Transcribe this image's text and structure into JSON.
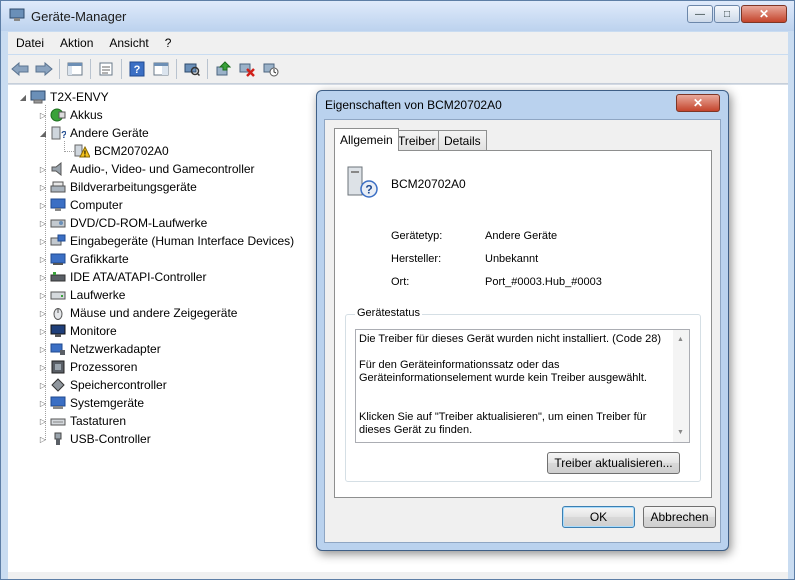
{
  "window": {
    "title": "Geräte-Manager",
    "minimize": "—",
    "maximize": "□",
    "close": "✕"
  },
  "menu": [
    "Datei",
    "Aktion",
    "Ansicht",
    "?"
  ],
  "toolbar_icons": [
    "back-arrow-icon",
    "forward-arrow-icon",
    "console-tree-icon",
    "properties-icon",
    "help-icon",
    "show-hide-icon",
    "scan-hardware-icon",
    "update-driver-icon",
    "uninstall-icon",
    "disable-icon"
  ],
  "tree": {
    "root": "T2X-ENVY",
    "items": [
      {
        "label": "Akkus",
        "expanded": false
      },
      {
        "label": "Andere Geräte",
        "expanded": true,
        "children": [
          "BCM20702A0"
        ]
      },
      {
        "label": "Audio-, Video- und Gamecontroller",
        "expanded": false
      },
      {
        "label": "Bildverarbeitungsgeräte",
        "expanded": false
      },
      {
        "label": "Computer",
        "expanded": false
      },
      {
        "label": "DVD/CD-ROM-Laufwerke",
        "expanded": false
      },
      {
        "label": "Eingabegeräte (Human Interface Devices)",
        "expanded": false
      },
      {
        "label": "Grafikkarte",
        "expanded": false
      },
      {
        "label": "IDE ATA/ATAPI-Controller",
        "expanded": false
      },
      {
        "label": "Laufwerke",
        "expanded": false
      },
      {
        "label": "Mäuse und andere Zeigegeräte",
        "expanded": false
      },
      {
        "label": "Monitore",
        "expanded": false
      },
      {
        "label": "Netzwerkadapter",
        "expanded": false
      },
      {
        "label": "Prozessoren",
        "expanded": false
      },
      {
        "label": "Speichercontroller",
        "expanded": false
      },
      {
        "label": "Systemgeräte",
        "expanded": false
      },
      {
        "label": "Tastaturen",
        "expanded": false
      },
      {
        "label": "USB-Controller",
        "expanded": false
      }
    ]
  },
  "dialog": {
    "title": "Eigenschaften von BCM20702A0",
    "close": "✕",
    "tabs": [
      "Allgemein",
      "Treiber",
      "Details"
    ],
    "active_tab": "Allgemein",
    "device_name": "BCM20702A0",
    "props": [
      {
        "label": "Gerätetyp:",
        "value": "Andere Geräte"
      },
      {
        "label": "Hersteller:",
        "value": "Unbekannt"
      },
      {
        "label": "Ort:",
        "value": "Port_#0003.Hub_#0003"
      }
    ],
    "status_group": "Gerätestatus",
    "status_text": "Die Treiber für dieses Gerät wurden nicht installiert. (Code 28)\n\nFür den Geräteinformationssatz oder das Geräteinformationselement wurde kein Treiber ausgewählt.\n\n\nKlicken Sie auf \"Treiber aktualisieren\", um einen Treiber für dieses Gerät zu finden.",
    "update_button": "Treiber aktualisieren...",
    "ok": "OK",
    "cancel": "Abbrechen"
  },
  "colors": {
    "title_bar": "#c9dcf1",
    "close_red": "#c4442c",
    "default_button": "#3c7fb1",
    "warning_yellow": "#f4c21b"
  }
}
